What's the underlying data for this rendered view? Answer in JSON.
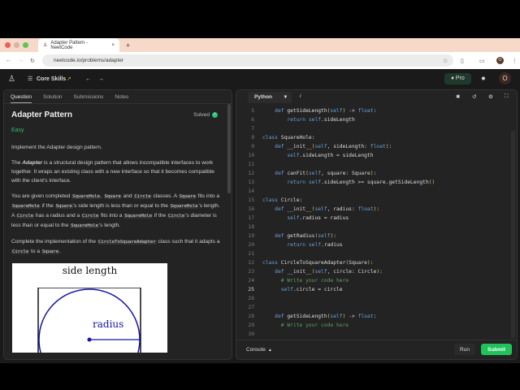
{
  "browser": {
    "tab_title": "Adapter Pattern - NeetCode",
    "url": "neetcode.io/problems/adapter",
    "profile": "O"
  },
  "header": {
    "course": "Core Skills",
    "pro": "Pro",
    "avatar": "O"
  },
  "left": {
    "tabs": [
      "Question",
      "Solution",
      "Submissions",
      "Notes"
    ],
    "title": "Adapter Pattern",
    "status": "Solved",
    "difficulty": "Easy",
    "intro": "Implement the Adapter design pattern.",
    "p2a": "The ",
    "p2b": "Adapter",
    "p2c": " is a structural design pattern that allows incompatible interfaces to work together. It wraps an existing class with a new interface so that it becomes compatible with the client's interface.",
    "p3": [
      "You are given completed ",
      "SquareHole",
      ", ",
      "Square",
      " and ",
      "Circle",
      " classes. A ",
      "Square",
      " fits into a ",
      "SquareHole",
      " if the ",
      "Square",
      "'s side length is less than or equal to the ",
      "SquareHole",
      "'s length. A ",
      "Circle",
      " has a radius and a ",
      "Circle",
      " fits into a ",
      "SquareHole",
      " if the ",
      "Circle",
      "'s diameter is less than or equal to the ",
      "SquareHole",
      "'s length."
    ],
    "p4": [
      "Complete the implementation of the ",
      "CircleToSquareAdapter",
      " class such that it adapts a ",
      "Circle",
      " to a ",
      "Square",
      "."
    ],
    "figure": {
      "top_label": "side length",
      "radius_label": "radius"
    }
  },
  "editor": {
    "language": "Python",
    "console": "Console",
    "run": "Run",
    "submit": "Submit",
    "lines": [
      {
        "n": "5",
        "t": "    def getSideLength(self) -> float:"
      },
      {
        "n": "6",
        "t": "        return self.sideLength"
      },
      {
        "n": "7",
        "t": ""
      },
      {
        "n": "8",
        "t": "class SquareHole:"
      },
      {
        "n": "9",
        "t": "    def __init__(self, sideLength: float):"
      },
      {
        "n": "10",
        "t": "        self.sideLength = sideLength"
      },
      {
        "n": "11",
        "t": ""
      },
      {
        "n": "12",
        "t": "    def canFit(self, square: Square):"
      },
      {
        "n": "13",
        "t": "        return self.sideLength >= square.getSideLength()"
      },
      {
        "n": "14",
        "t": ""
      },
      {
        "n": "15",
        "t": "class Circle:"
      },
      {
        "n": "16",
        "t": "    def __init__(self, radius: float):"
      },
      {
        "n": "17",
        "t": "        self.radius = radius"
      },
      {
        "n": "18",
        "t": ""
      },
      {
        "n": "19",
        "t": "    def getRadius(self):"
      },
      {
        "n": "20",
        "t": "        return self.radius"
      },
      {
        "n": "21",
        "t": ""
      },
      {
        "n": "22",
        "t": "class CircleToSquareAdapter(Square):"
      },
      {
        "n": "23",
        "t": "    def __init__(self, circle: Circle):"
      },
      {
        "n": "24",
        "t": "      # Write your code here"
      },
      {
        "n": "25",
        "t": "      self.circle = circle"
      },
      {
        "n": "26",
        "t": ""
      },
      {
        "n": "27",
        "t": ""
      },
      {
        "n": "28",
        "t": "    def getSideLength(self) -> float:"
      },
      {
        "n": "29",
        "t": "      # Write your code here"
      },
      {
        "n": "30",
        "t": ""
      }
    ]
  }
}
